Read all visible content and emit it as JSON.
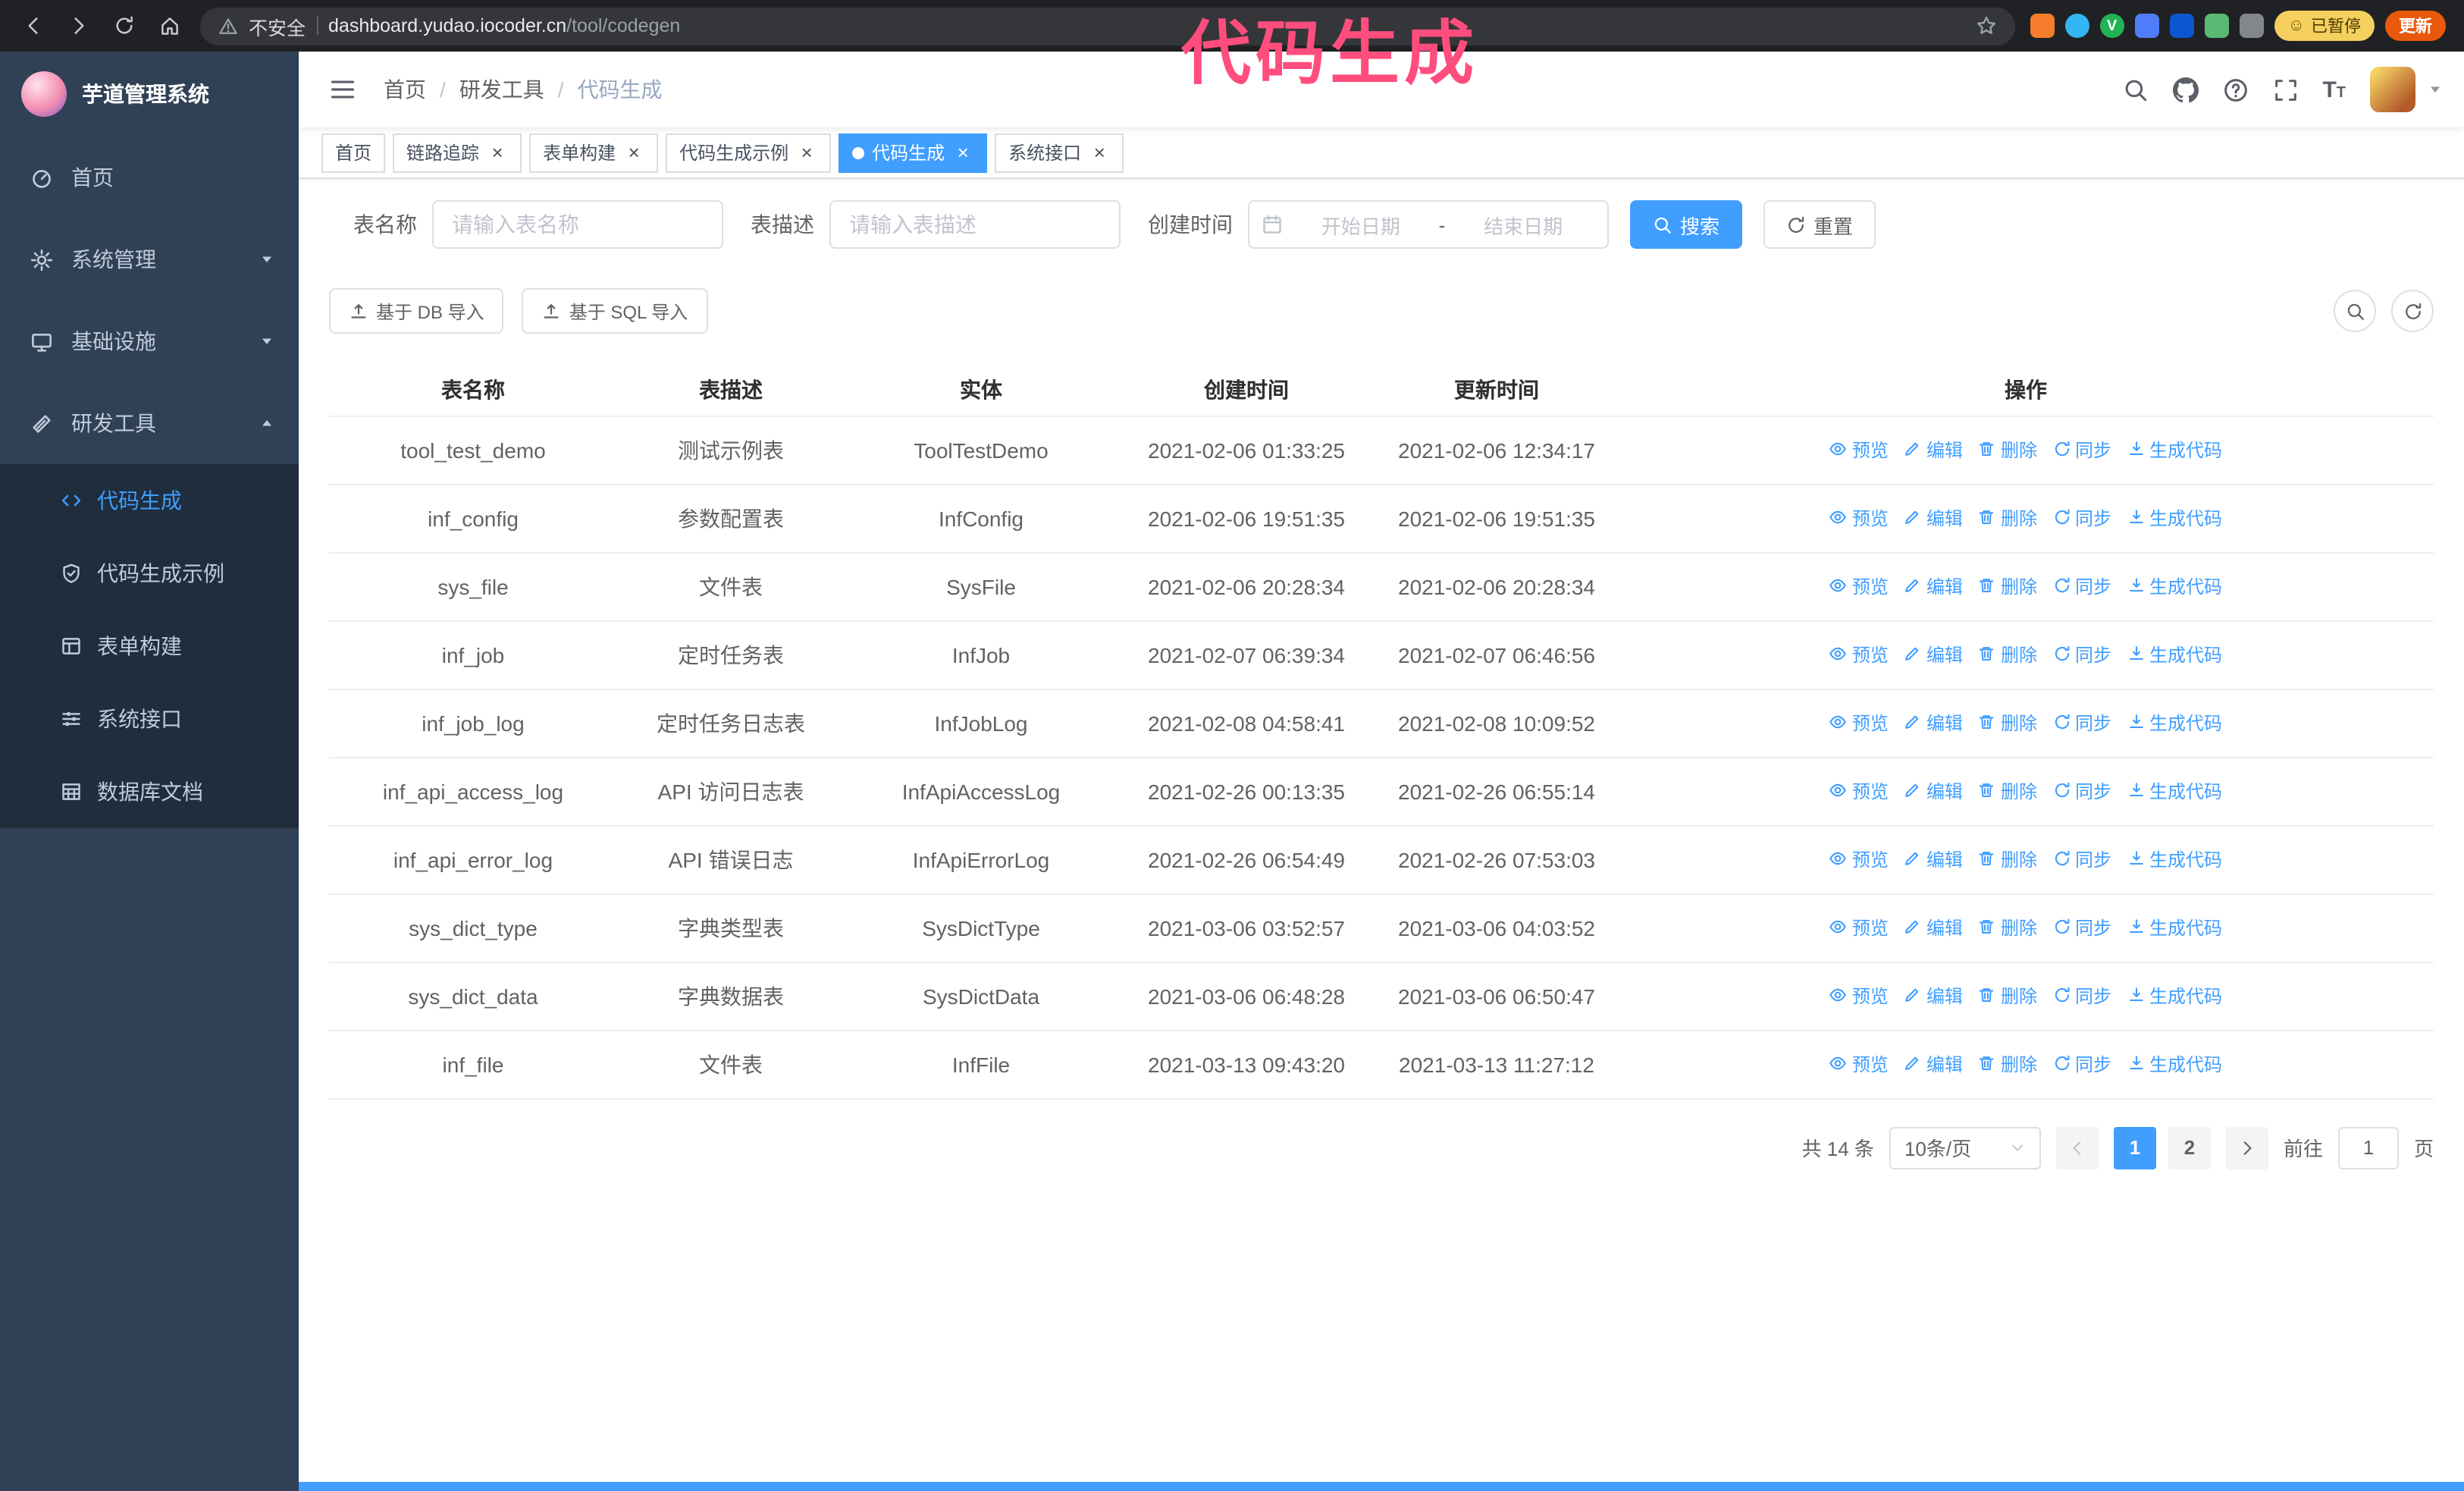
{
  "browser": {
    "security_label": "不安全",
    "url_domain": "dashboard.yudao.iocoder.cn",
    "url_path": "/tool/codegen",
    "paused_badge": "已暂停",
    "update_button": "更新"
  },
  "annotation": {
    "text": "代码生成",
    "color": "#ff4d7d"
  },
  "sidebar": {
    "logo_title": "芋道管理系统",
    "items": [
      {
        "label": "首页",
        "icon": "dashboard",
        "expandable": false,
        "expanded": false
      },
      {
        "label": "系统管理",
        "icon": "gear",
        "expandable": true,
        "expanded": false
      },
      {
        "label": "基础设施",
        "icon": "monitor",
        "expandable": true,
        "expanded": false
      },
      {
        "label": "研发工具",
        "icon": "tool",
        "expandable": true,
        "expanded": true
      }
    ],
    "subitems": [
      {
        "label": "代码生成",
        "icon": "code",
        "active": true
      },
      {
        "label": "代码生成示例",
        "icon": "shield",
        "active": false
      },
      {
        "label": "表单构建",
        "icon": "form",
        "active": false
      },
      {
        "label": "系统接口",
        "icon": "api",
        "active": false
      },
      {
        "label": "数据库文档",
        "icon": "database",
        "active": false
      }
    ]
  },
  "navbar": {
    "breadcrumb": [
      {
        "label": "首页"
      },
      {
        "label": "研发工具"
      },
      {
        "label": "代码生成"
      }
    ]
  },
  "tabs": [
    {
      "label": "首页",
      "closable": false,
      "active": false
    },
    {
      "label": "链路追踪",
      "closable": true,
      "active": false
    },
    {
      "label": "表单构建",
      "closable": true,
      "active": false
    },
    {
      "label": "代码生成示例",
      "closable": true,
      "active": false
    },
    {
      "label": "代码生成",
      "closable": true,
      "active": true
    },
    {
      "label": "系统接口",
      "closable": true,
      "active": false
    }
  ],
  "filters": {
    "table_name_label": "表名称",
    "table_name_placeholder": "请输入表名称",
    "table_desc_label": "表描述",
    "table_desc_placeholder": "请输入表描述",
    "create_time_label": "创建时间",
    "date_start_placeholder": "开始日期",
    "date_separator": "-",
    "date_end_placeholder": "结束日期",
    "search_button": "搜索",
    "reset_button": "重置"
  },
  "toolbar": {
    "import_db": "基于 DB 导入",
    "import_sql": "基于 SQL 导入"
  },
  "table": {
    "columns": [
      "表名称",
      "表描述",
      "实体",
      "创建时间",
      "更新时间",
      "操作"
    ],
    "actions": [
      {
        "label": "预览",
        "icon": "eye",
        "name": "preview"
      },
      {
        "label": "编辑",
        "icon": "edit",
        "name": "edit"
      },
      {
        "label": "删除",
        "icon": "trash",
        "name": "delete"
      },
      {
        "label": "同步",
        "icon": "sync",
        "name": "sync"
      },
      {
        "label": "生成代码",
        "icon": "download",
        "name": "generate-code"
      }
    ],
    "rows": [
      {
        "name": "tool_test_demo",
        "desc": "测试示例表",
        "entity": "ToolTestDemo",
        "created": "2021-02-06 01:33:25",
        "updated": "2021-02-06 12:34:17"
      },
      {
        "name": "inf_config",
        "desc": "参数配置表",
        "entity": "InfConfig",
        "created": "2021-02-06 19:51:35",
        "updated": "2021-02-06 19:51:35"
      },
      {
        "name": "sys_file",
        "desc": "文件表",
        "entity": "SysFile",
        "created": "2021-02-06 20:28:34",
        "updated": "2021-02-06 20:28:34"
      },
      {
        "name": "inf_job",
        "desc": "定时任务表",
        "entity": "InfJob",
        "created": "2021-02-07 06:39:34",
        "updated": "2021-02-07 06:46:56"
      },
      {
        "name": "inf_job_log",
        "desc": "定时任务日志表",
        "entity": "InfJobLog",
        "created": "2021-02-08 04:58:41",
        "updated": "2021-02-08 10:09:52"
      },
      {
        "name": "inf_api_access_log",
        "desc": "API 访问日志表",
        "entity": "InfApiAccessLog",
        "created": "2021-02-26 00:13:35",
        "updated": "2021-02-26 06:55:14"
      },
      {
        "name": "inf_api_error_log",
        "desc": "API 错误日志",
        "entity": "InfApiErrorLog",
        "created": "2021-02-26 06:54:49",
        "updated": "2021-02-26 07:53:03"
      },
      {
        "name": "sys_dict_type",
        "desc": "字典类型表",
        "entity": "SysDictType",
        "created": "2021-03-06 03:52:57",
        "updated": "2021-03-06 04:03:52"
      },
      {
        "name": "sys_dict_data",
        "desc": "字典数据表",
        "entity": "SysDictData",
        "created": "2021-03-06 06:48:28",
        "updated": "2021-03-06 06:50:47"
      },
      {
        "name": "inf_file",
        "desc": "文件表",
        "entity": "InfFile",
        "created": "2021-03-13 09:43:20",
        "updated": "2021-03-13 11:27:12"
      }
    ]
  },
  "pagination": {
    "total": "共 14 条",
    "page_size": "10条/页",
    "pages": [
      "1",
      "2"
    ],
    "active_page": "1",
    "prev_disabled": true,
    "goto_label": "前往",
    "goto_value": "1",
    "page_suffix": "页"
  }
}
